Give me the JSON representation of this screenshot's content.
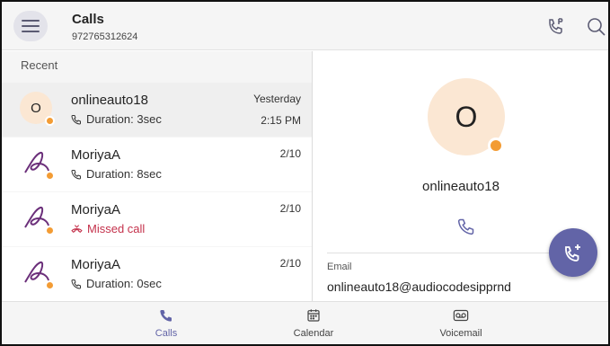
{
  "header": {
    "title": "Calls",
    "subtitle": "972765312624"
  },
  "list": {
    "section_label": "Recent",
    "items": [
      {
        "name": "onlineauto18",
        "detail": "Duration: 3sec",
        "date": "Yesterday",
        "time": "2:15 PM",
        "avatar_text": "O",
        "selected": true,
        "missed": false
      },
      {
        "name": "MoriyaA",
        "detail": "Duration: 8sec",
        "date": "2/10",
        "time": "",
        "avatar_text": "",
        "selected": false,
        "missed": false
      },
      {
        "name": "MoriyaA",
        "detail": "Missed call",
        "date": "2/10",
        "time": "",
        "avatar_text": "",
        "selected": false,
        "missed": true
      },
      {
        "name": "MoriyaA",
        "detail": "Duration: 0sec",
        "date": "2/10",
        "time": "",
        "avatar_text": "",
        "selected": false,
        "missed": false
      }
    ]
  },
  "detail": {
    "avatar_text": "O",
    "name": "onlineauto18",
    "email_label": "Email",
    "email": "onlineauto18@audiocodesipprnd"
  },
  "nav": {
    "calls": "Calls",
    "calendar": "Calendar",
    "voicemail": "Voicemail"
  },
  "colors": {
    "accent": "#6264a7",
    "presence": "#f39c34",
    "missed": "#c4314b",
    "avatar_bg": "#fbe7d3"
  },
  "icons": {
    "menu": "hamburger-icon",
    "dialpad": "phone-dialpad-icon",
    "search": "search-icon",
    "call": "phone-icon",
    "missed": "missed-call-icon",
    "add_call": "add-call-icon",
    "calendar": "calendar-icon",
    "voicemail": "voicemail-icon"
  }
}
